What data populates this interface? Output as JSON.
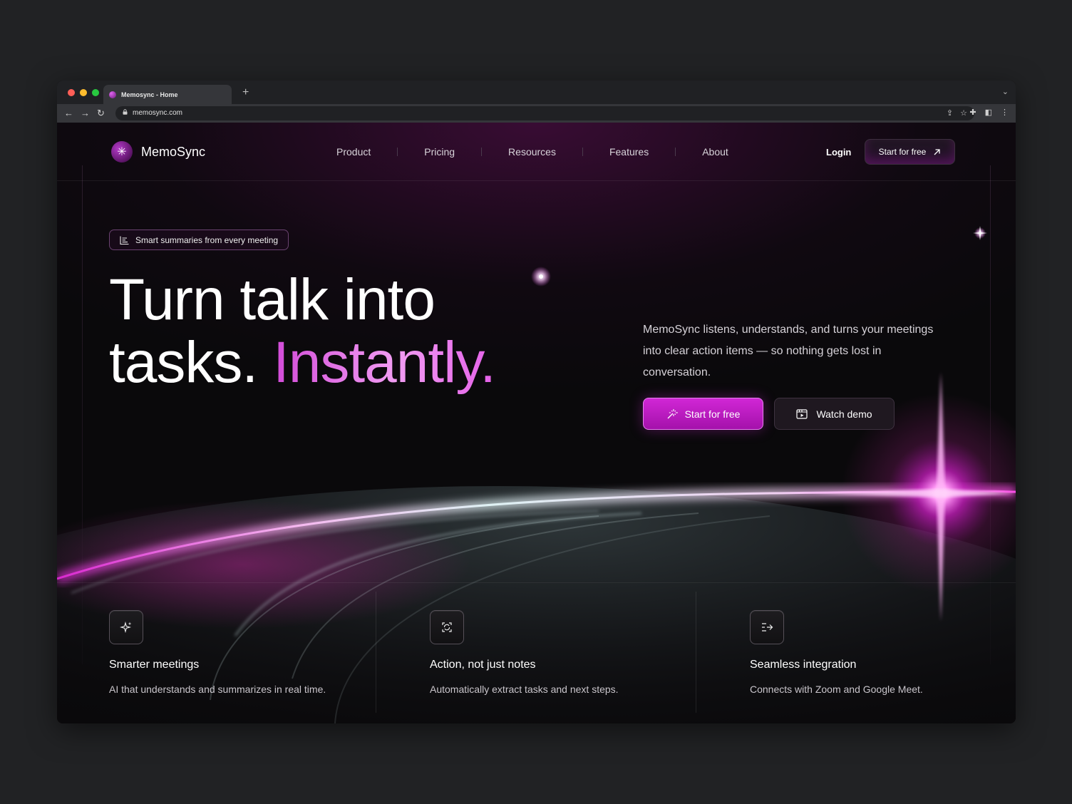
{
  "browser": {
    "tab_title": "Memosync - Home",
    "new_tab": "+",
    "url": "memosync.com",
    "traffic_lights": [
      "#ff5f57",
      "#febc2e",
      "#28c840"
    ]
  },
  "nav": {
    "logo_text": "MemoSync",
    "logo_glyph": "✳",
    "menu": [
      "Product",
      "Pricing",
      "Resources",
      "Features",
      "About"
    ],
    "login": "Login",
    "cta": "Start for free"
  },
  "hero": {
    "badge": "Smart summaries from every meeting",
    "headline_line1": "Turn talk into",
    "headline_line2_plain": "tasks. ",
    "headline_line2_accent": "Instantly.",
    "lede": "MemoSync listens, understands, and turns your meetings into clear action items — so nothing gets lost in conversation.",
    "primary_cta": "Start for free",
    "secondary_cta": "Watch demo"
  },
  "features": [
    {
      "icon": "sparkle-icon",
      "title": "Smarter meetings",
      "desc": "AI that understands and summarizes in real time."
    },
    {
      "icon": "refresh-icon",
      "title": "Action, not just notes",
      "desc": "Automatically extract tasks and next steps."
    },
    {
      "icon": "integration-icon",
      "title": "Seamless integration",
      "desc": "Connects with Zoom and Google Meet."
    }
  ],
  "colors": {
    "accent": "#d127d6",
    "background": "#0a090b",
    "headline_accent": "#e878ec"
  }
}
